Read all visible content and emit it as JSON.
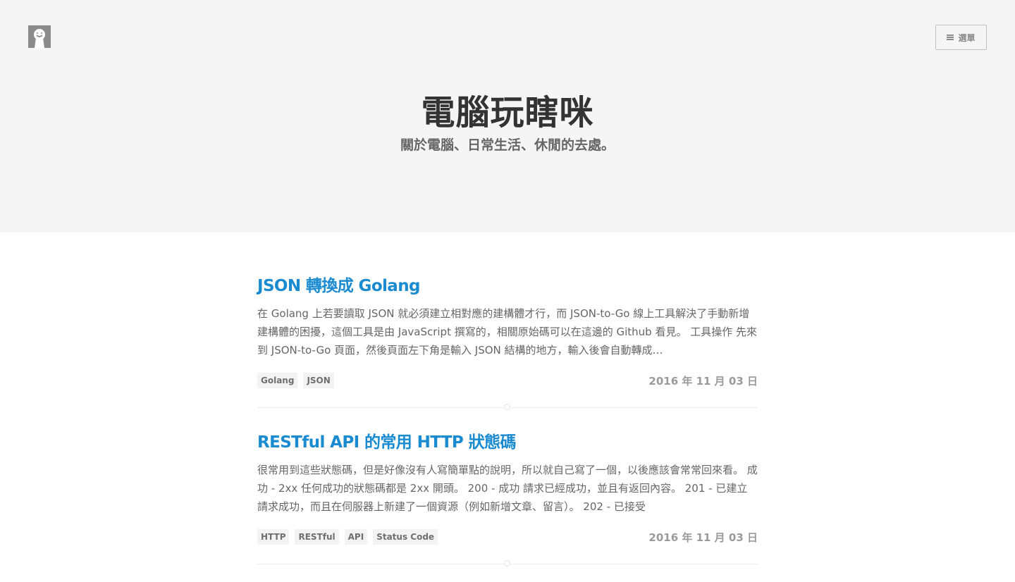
{
  "site": {
    "title": "電腦玩瞎咪",
    "description": "關於電腦、日常生活、休閒的去處。",
    "menu_label": "選單",
    "menu_icon": "hamburger-icon",
    "logo_icon": "avatar-icon"
  },
  "colors": {
    "accent": "#1a8bd0",
    "hero_bg": "#f5f5f5",
    "tag_bg": "#f3f3f3"
  },
  "posts": [
    {
      "title": "JSON 轉換成 Golang",
      "excerpt": "在 Golang 上若要讀取 JSON 就必須建立相對應的建構體才行，而 JSON-to-Go 線上工具解決了手動新增建構體的困擾，這個工具是由 JavaScript 撰寫的，相關原始碼可以在這邊的 Github 看見。 工具操作 先來到 JSON-to-Go 頁面，然後頁面左下角是輸入 JSON 結構的地方，輸入後會自動轉成…",
      "tags": [
        "Golang",
        "JSON"
      ],
      "date": "2016 年 11 月 03 日"
    },
    {
      "title": "RESTful API 的常用 HTTP 狀態碼",
      "excerpt": "很常用到這些狀態碼，但是好像沒有人寫簡單點的說明，所以就自己寫了一個，以後應該會常常回來看。 成功 - 2xx 任何成功的狀態碼都是 2xx 開頭。 200 - 成功 請求已經成功，並且有返回內容。 201 - 已建立 請求成功，而且在伺服器上新建了一個資源（例如新增文章、留言）。 202 - 已接受",
      "tags": [
        "HTTP",
        "RESTful",
        "API",
        "Status Code"
      ],
      "date": "2016 年 11 月 03 日"
    }
  ]
}
